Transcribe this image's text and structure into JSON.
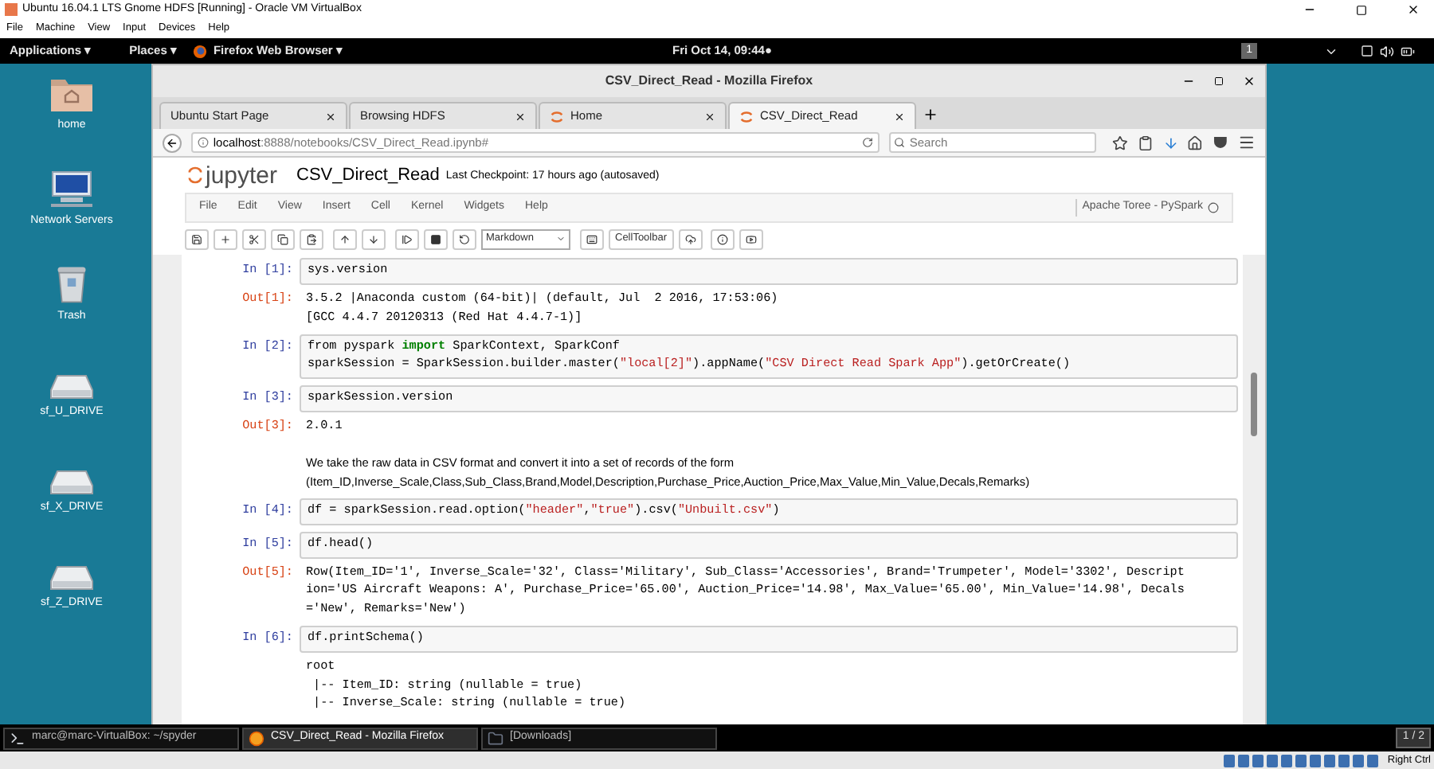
{
  "vbox": {
    "title": "Ubuntu 16.04.1 LTS Gnome HDFS [Running] - Oracle VM VirtualBox",
    "menu": [
      "File",
      "Machine",
      "View",
      "Input",
      "Devices",
      "Help"
    ]
  },
  "top_bar": {
    "applications": "Applications ▾",
    "places": "Places ▾",
    "app_menu": "Firefox Web Browser ▾",
    "clock": "Fri Oct 14, 09:44●",
    "workspace": "1"
  },
  "desktop_icons": [
    {
      "label": "home",
      "kind": "folder"
    },
    {
      "label": "Network Servers",
      "kind": "network"
    },
    {
      "label": "Trash",
      "kind": "trash"
    },
    {
      "label": "sf_U_DRIVE",
      "kind": "drive"
    },
    {
      "label": "sf_X_DRIVE",
      "kind": "drive"
    },
    {
      "label": "sf_Z_DRIVE",
      "kind": "drive"
    }
  ],
  "firefox": {
    "title": "CSV_Direct_Read - Mozilla Firefox",
    "tabs": [
      {
        "label": "Ubuntu Start Page",
        "selected": false,
        "kind": "plain"
      },
      {
        "label": "Browsing HDFS",
        "selected": false,
        "kind": "plain"
      },
      {
        "label": "Home",
        "selected": false,
        "kind": "jupyter"
      },
      {
        "label": "CSV_Direct_Read",
        "selected": true,
        "kind": "jupyter"
      }
    ],
    "url_host": "localhost",
    "url_path": ":8888/notebooks/CSV_Direct_Read.ipynb#",
    "search": {
      "placeholder": "Search"
    }
  },
  "jupyter": {
    "logo": "jupyter",
    "notebook_name": "CSV_Direct_Read",
    "checkpoint": "Last Checkpoint: 17 hours ago (autosaved)",
    "menu": [
      "File",
      "Edit",
      "View",
      "Insert",
      "Cell",
      "Kernel",
      "Widgets",
      "Help"
    ],
    "kernel": "Apache Toree - PySpark",
    "cell_type": "Markdown",
    "cell_toolbar": "CellToolbar",
    "cells": [
      {
        "kind": "code",
        "prompt": "In [1]:",
        "lines": [
          [
            {
              "text": "sys.version",
              "kind": "plain"
            }
          ]
        ]
      },
      {
        "kind": "output",
        "prompt": "Out[1]:",
        "lines": [
          "3.5.2 |Anaconda custom (64-bit)| (default, Jul  2 2016, 17:53:06) ",
          "[GCC 4.4.7 20120313 (Red Hat 4.4.7-1)]"
        ]
      },
      {
        "kind": "code",
        "prompt": "In [2]:",
        "lines": [
          [
            {
              "text": "from pyspark ",
              "kind": "plain"
            },
            {
              "text": "import",
              "kind": "keyword"
            },
            {
              "text": " SparkContext, SparkConf",
              "kind": "plain"
            }
          ],
          [
            {
              "text": "sparkSession = SparkSession.builder.master(",
              "kind": "plain"
            },
            {
              "text": "\"local[2]\"",
              "kind": "string"
            },
            {
              "text": ").appName(",
              "kind": "plain"
            },
            {
              "text": "\"CSV Direct Read Spark App\"",
              "kind": "string"
            },
            {
              "text": ").getOrCreate()",
              "kind": "plain"
            }
          ]
        ]
      },
      {
        "kind": "code",
        "prompt": "In [3]:",
        "lines": [
          [
            {
              "text": "sparkSession.version",
              "kind": "plain"
            }
          ]
        ]
      },
      {
        "kind": "output",
        "prompt": "Out[3]:",
        "lines": [
          "2.0.1"
        ]
      },
      {
        "kind": "markdown",
        "lines": [
          "We take the raw data in CSV format and convert it into a set of records of the form",
          "(Item_ID,Inverse_Scale,Class,Sub_Class,Brand,Model,Description,Purchase_Price,Auction_Price,Max_Value,Min_Value,Decals,Remarks)"
        ]
      },
      {
        "kind": "code",
        "prompt": "In [4]:",
        "lines": [
          [
            {
              "text": "df = sparkSession.read.option(",
              "kind": "plain"
            },
            {
              "text": "\"header\"",
              "kind": "string"
            },
            {
              "text": ",",
              "kind": "plain"
            },
            {
              "text": "\"true\"",
              "kind": "string"
            },
            {
              "text": ").csv(",
              "kind": "plain"
            },
            {
              "text": "\"Unbuilt.csv\"",
              "kind": "string"
            },
            {
              "text": ")",
              "kind": "plain"
            }
          ]
        ]
      },
      {
        "kind": "code",
        "prompt": "In [5]:",
        "lines": [
          [
            {
              "text": "df.head()",
              "kind": "plain"
            }
          ]
        ]
      },
      {
        "kind": "output",
        "prompt": "Out[5]:",
        "lines": [
          "Row(Item_ID='1', Inverse_Scale='32', Class='Military', Sub_Class='Accessories', Brand='Trumpeter', Model='3302', Descript",
          "ion='US Aircraft Weapons: A', Purchase_Price='65.00', Auction_Price='14.98', Max_Value='65.00', Min_Value='14.98', Decals",
          "='New', Remarks='New')"
        ]
      },
      {
        "kind": "code",
        "prompt": "In [6]:",
        "lines": [
          [
            {
              "text": "df.printSchema()",
              "kind": "plain"
            }
          ]
        ]
      },
      {
        "kind": "output",
        "lines": [
          "root",
          " |-- Item_ID: string (nullable = true)",
          " |-- Inverse_Scale: string (nullable = true)"
        ]
      }
    ]
  },
  "taskbar": {
    "items": [
      {
        "label": "marc@marc-VirtualBox: ~/spyder",
        "kind": "terminal",
        "selected": false
      },
      {
        "label": "CSV_Direct_Read - Mozilla Firefox",
        "kind": "browser",
        "selected": true
      },
      {
        "label": "[Downloads]",
        "kind": "files",
        "selected": false
      }
    ],
    "pager": "1 / 2"
  },
  "status_bar": {
    "host_key": "Right Ctrl"
  }
}
